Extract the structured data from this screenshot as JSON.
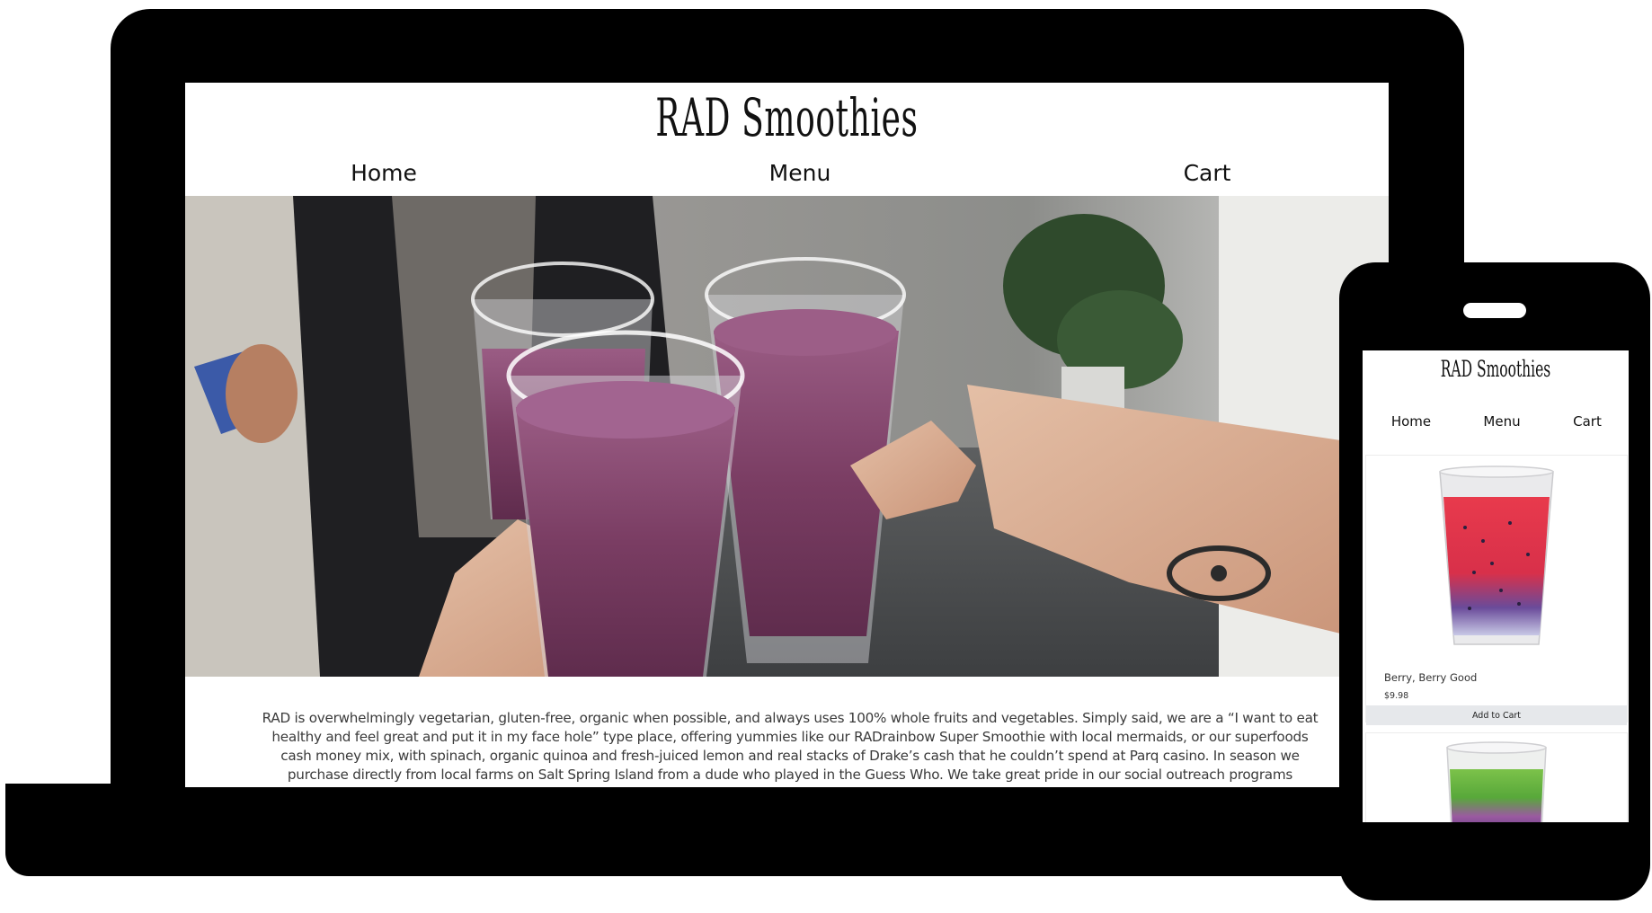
{
  "desktop": {
    "site_title": "RAD Smoothies",
    "nav": {
      "home": "Home",
      "menu": "Menu",
      "cart": "Cart"
    },
    "hero_image": "three-smoothie-glasses-toast",
    "about_lines": [
      "RAD is overwhelmingly vegetarian, gluten-free, organic when possible, and always uses 100% whole fruits and vegetables. Simply said, we are a “I want to eat",
      "healthy and feel great and put it in my face hole” type place, offering yummies like our RADrainbow Super Smoothie with local mermaids, or our superfoods",
      "cash money mix, with spinach, organic quinoa and fresh-juiced lemon and real stacks of Drake’s cash that he couldn’t spend at Parq casino. In season we",
      "purchase directly from local farms on Salt Spring Island from a dude who played in the Guess Who. We take great pride in our social outreach programs"
    ]
  },
  "mobile": {
    "site_title": "RAD Smoothies",
    "nav": {
      "home": "Home",
      "menu": "Menu",
      "cart": "Cart"
    },
    "products": [
      {
        "name": "Berry, Berry Good",
        "price": "$9.98",
        "button": "Add to Cart",
        "image": "red-berry-smoothie-glass"
      },
      {
        "image": "rainbow-smoothie-glass"
      }
    ]
  },
  "colors": {
    "device_frame": "#000000",
    "smoothie_purple": "#7a3d63",
    "button_bg": "#e6e8eb"
  }
}
